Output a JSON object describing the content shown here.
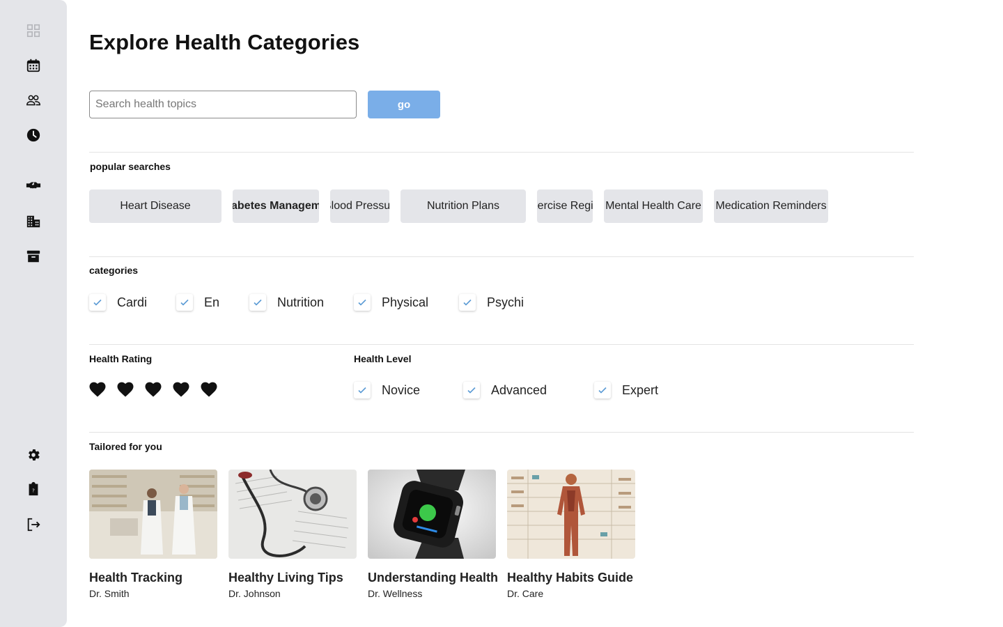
{
  "sidebar": {
    "top_items": [
      {
        "icon": "grid-icon"
      },
      {
        "icon": "calendar-icon"
      },
      {
        "icon": "users-icon"
      },
      {
        "icon": "clock-icon"
      },
      {
        "icon": "handshake-icon"
      },
      {
        "icon": "building-icon"
      },
      {
        "icon": "archive-icon"
      }
    ],
    "bottom_items": [
      {
        "icon": "gear-icon"
      },
      {
        "icon": "help-clipboard-icon"
      },
      {
        "icon": "logout-icon"
      }
    ]
  },
  "page": {
    "title": "Explore Health Categories"
  },
  "search": {
    "placeholder": "Search health topics",
    "value": "",
    "button_label": "go"
  },
  "popular": {
    "label": "popular searches",
    "chips": [
      {
        "label": "Heart Disease"
      },
      {
        "label": "Diabetes Management"
      },
      {
        "label": "Blood Pressure"
      },
      {
        "label": "Nutrition Plans"
      },
      {
        "label": "Exercise Regimen"
      },
      {
        "label": "Mental Health Care"
      },
      {
        "label": "Medication Reminders"
      }
    ]
  },
  "categories": {
    "label": "categories",
    "items": [
      {
        "label": "Cardi",
        "checked": true
      },
      {
        "label": "En",
        "checked": true
      },
      {
        "label": "Nutrition",
        "checked": true
      },
      {
        "label": "Physical",
        "checked": true
      },
      {
        "label": "Psychi",
        "checked": true
      }
    ]
  },
  "rating": {
    "label": "Health Rating",
    "value": 5,
    "max": 5
  },
  "level": {
    "label": "Health Level",
    "items": [
      {
        "label": "Novice",
        "checked": true
      },
      {
        "label": "Advanced",
        "checked": true
      },
      {
        "label": "Expert",
        "checked": true
      }
    ]
  },
  "tailored": {
    "label": "Tailored for you",
    "cards": [
      {
        "title": "Health Tracking",
        "author": "Dr. Smith"
      },
      {
        "title": "Healthy Living Tips",
        "author": "Dr. Johnson"
      },
      {
        "title": "Understanding Health",
        "author": "Dr. Wellness"
      },
      {
        "title": "Healthy Habits Guide",
        "author": "Dr. Care"
      }
    ]
  },
  "colors": {
    "sidebar_bg": "#e4e5e9",
    "accent": "#7aaee8",
    "check": "#5b9bd5",
    "chip_bg": "#e4e5e9"
  }
}
